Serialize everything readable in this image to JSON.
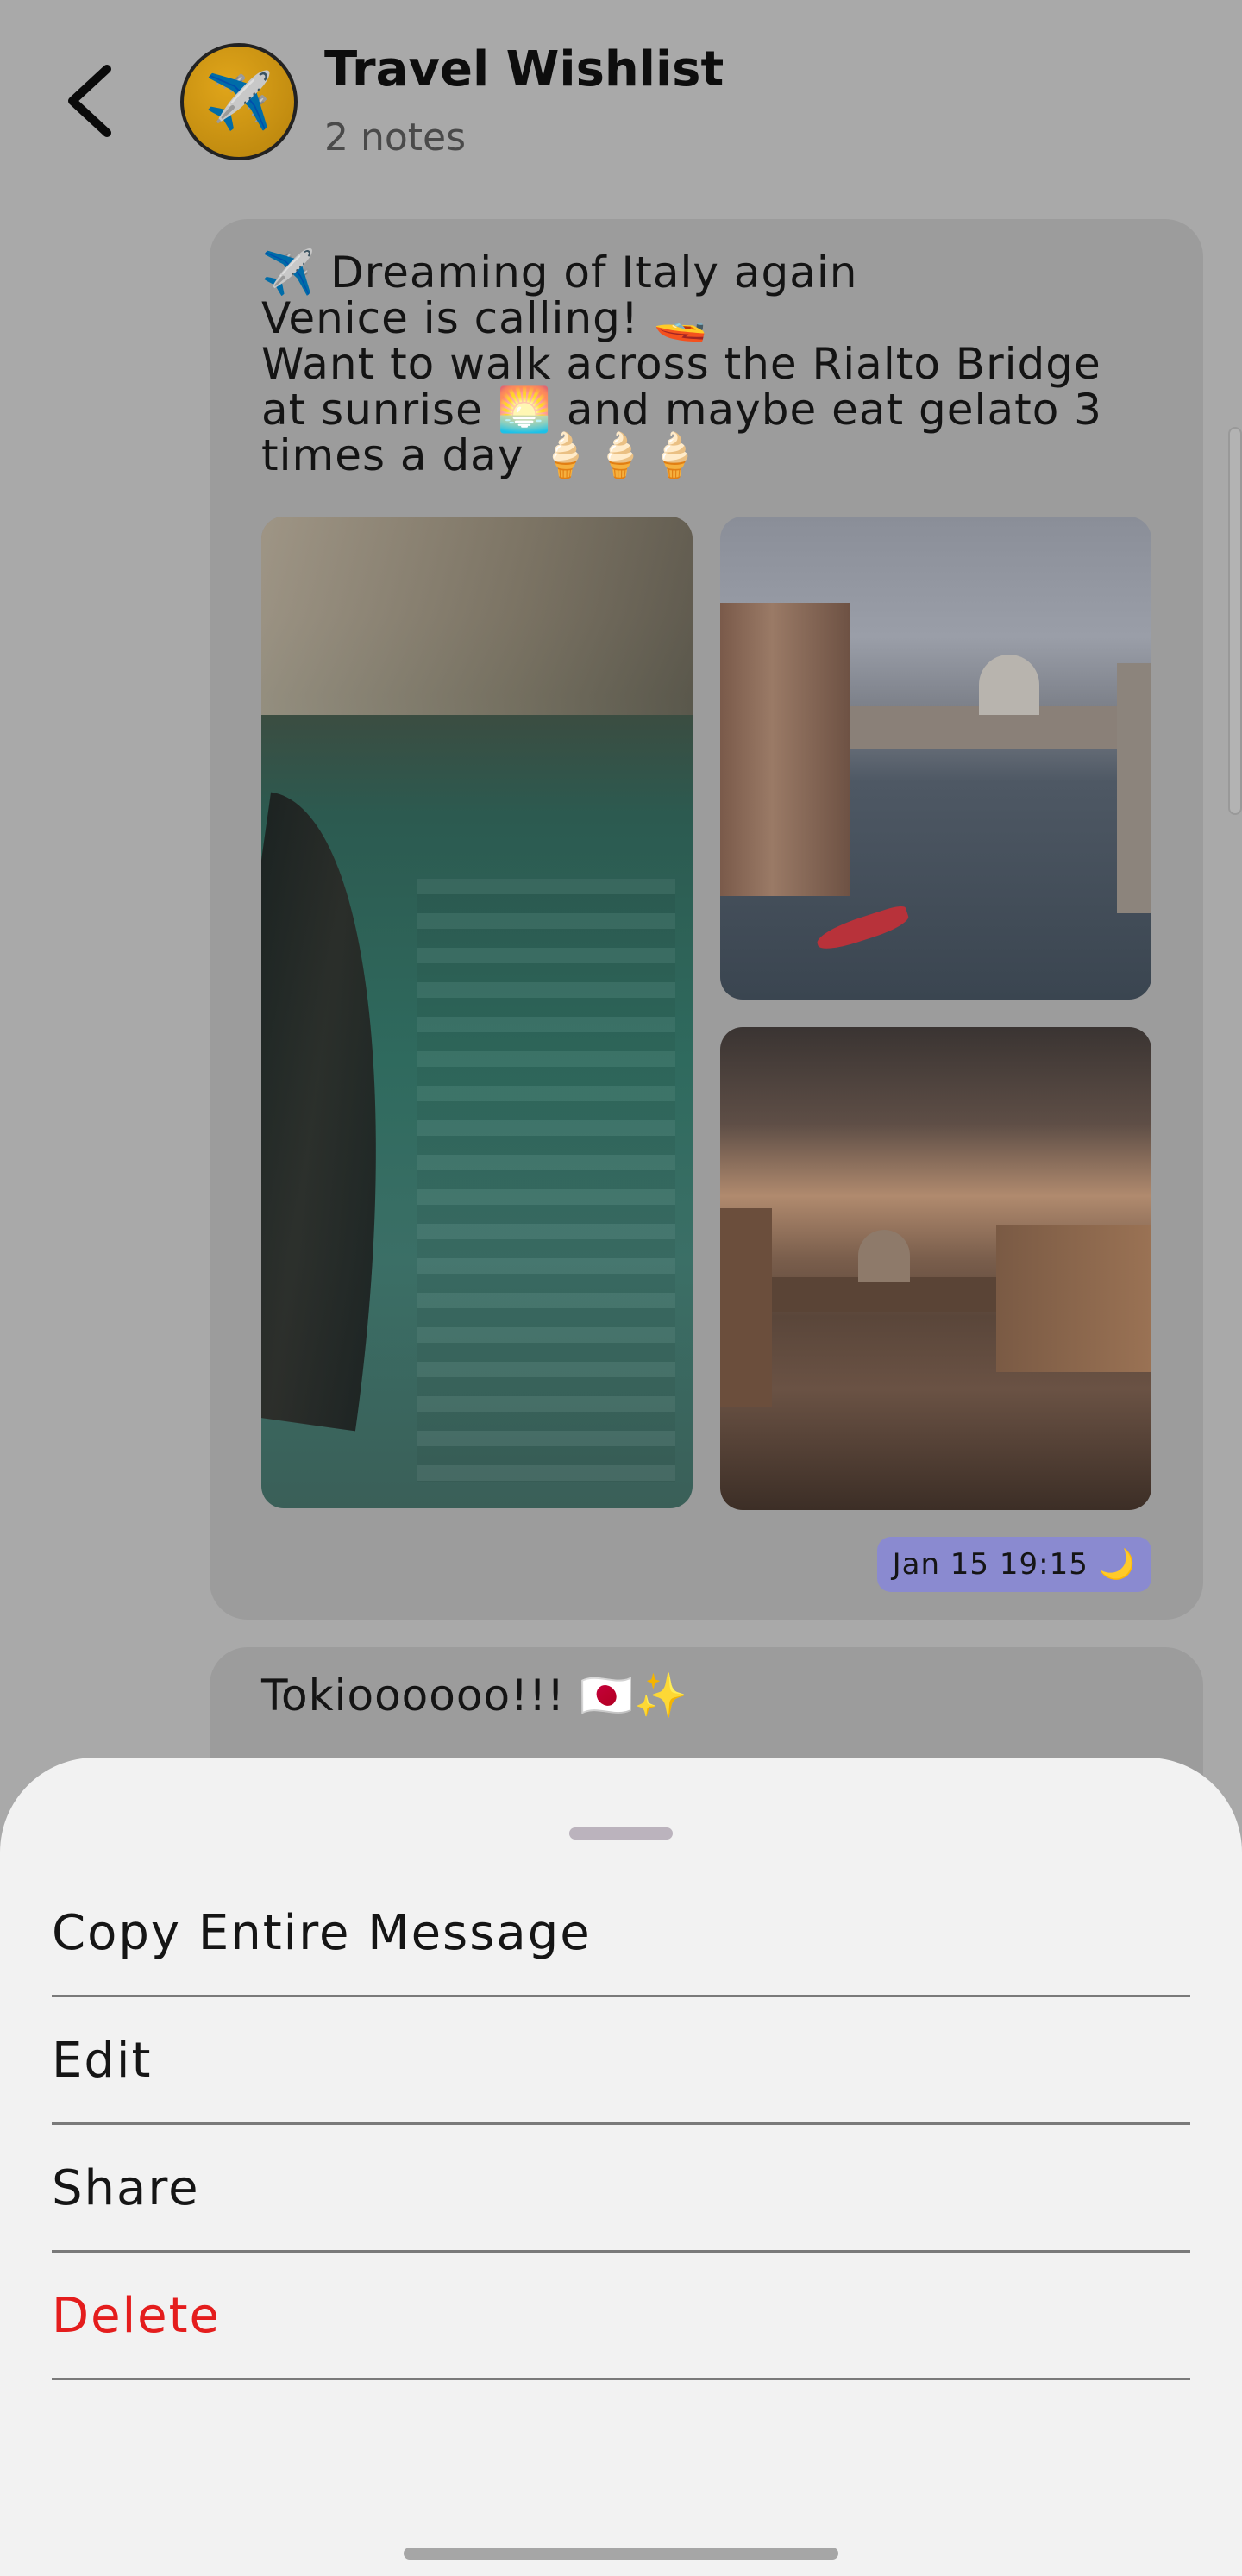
{
  "header": {
    "back_icon": "chevron-left-icon",
    "avatar_emoji": "✈️",
    "title": "Travel Wishlist",
    "subtitle": "2 notes"
  },
  "notes": [
    {
      "text": "✈️ Dreaming of Italy again\nVenice is calling! 🚤\nWant to walk across the Rialto Bridge at sunrise 🌅 and maybe eat gelato 3 times a day 🍦🍦🍦",
      "images": [
        "venice-canal-gondola-reflection",
        "venice-grand-canal-boat",
        "venice-grand-canal-sunset"
      ],
      "timestamp": "Jan 15 19:15 🌙"
    },
    {
      "text": "Tokioooooo!!! 🇯🇵✨"
    }
  ],
  "sheet": {
    "items": [
      {
        "label": "Copy Entire Message"
      },
      {
        "label": "Edit"
      },
      {
        "label": "Share"
      },
      {
        "label": "Delete",
        "color": "#e41d1d"
      }
    ]
  },
  "colors": {
    "overlay_background": "#a9a9a9",
    "card": "#9c9c9c",
    "timestamp_badge": "#8a8ad0",
    "sheet": "#f2f2f2",
    "danger": "#e41d1d"
  }
}
